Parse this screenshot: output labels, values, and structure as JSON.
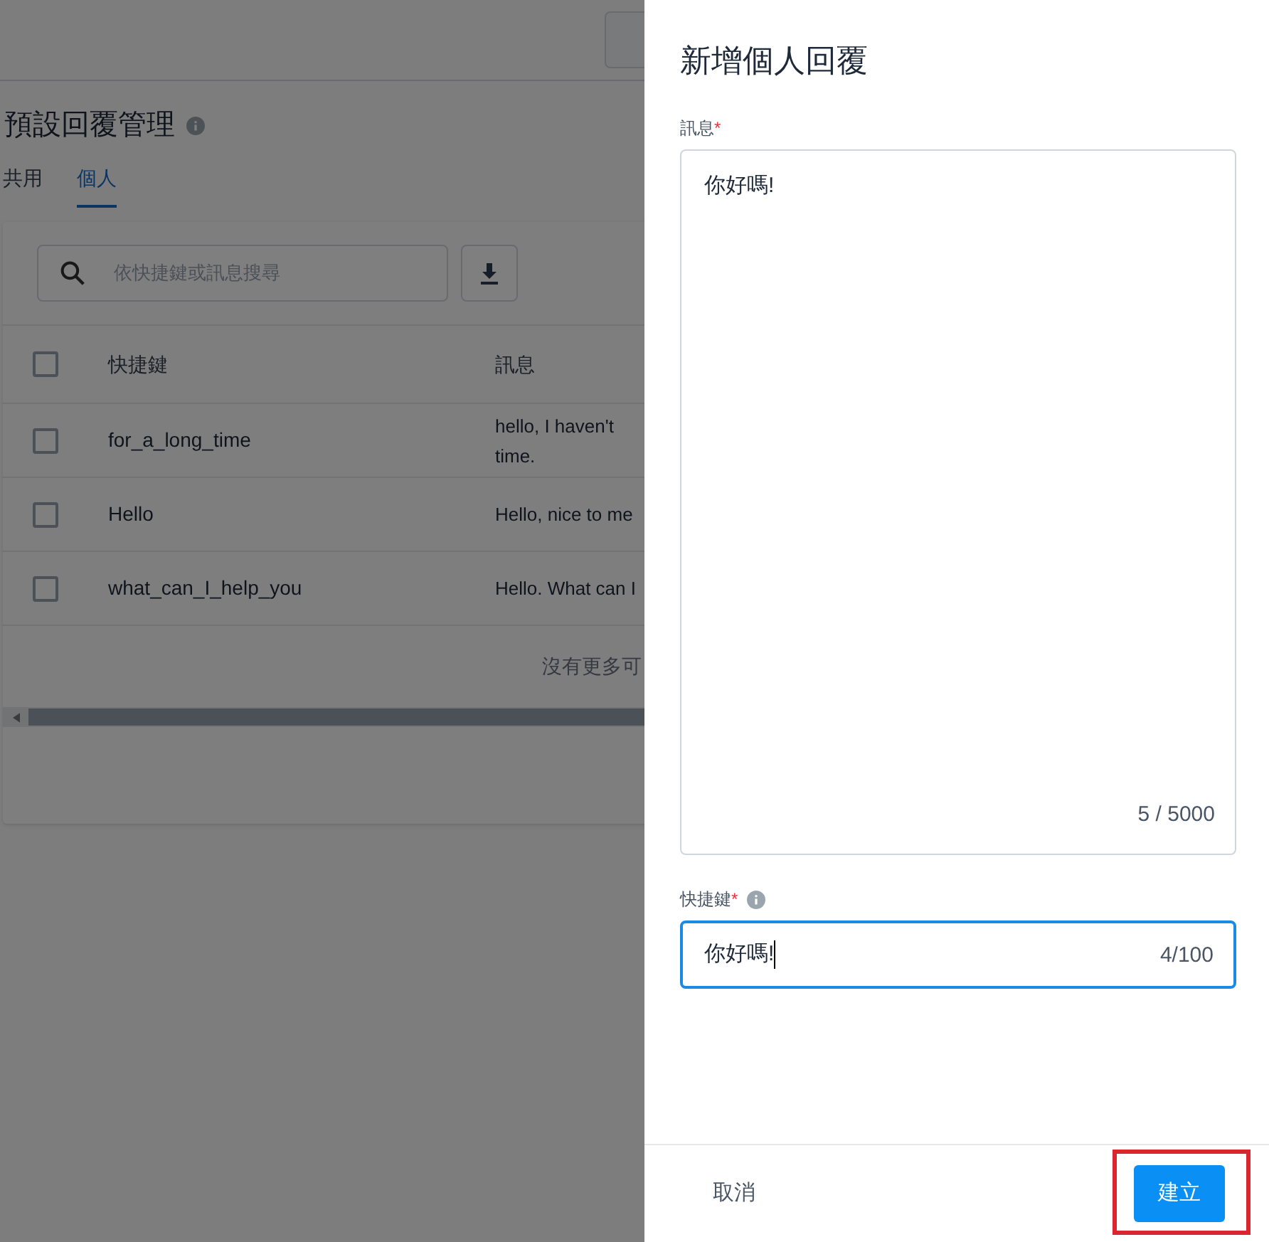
{
  "page": {
    "title": "預設回覆管理",
    "tabs": [
      {
        "label": "共用",
        "selected": false
      },
      {
        "label": "個人",
        "selected": true
      }
    ],
    "search": {
      "placeholder": "依快捷鍵或訊息搜尋"
    },
    "table": {
      "columns": [
        "快捷鍵",
        "訊息"
      ],
      "header_checked": false,
      "rows": [
        {
          "checked": false,
          "shortcut": "for_a_long_time",
          "message_lines": [
            "hello, I haven't",
            "time."
          ]
        },
        {
          "checked": false,
          "shortcut": "Hello",
          "message_lines": [
            "Hello, nice to me"
          ]
        },
        {
          "checked": false,
          "shortcut": "what_can_I_help_you",
          "message_lines": [
            "Hello. What can I"
          ]
        }
      ],
      "footer_note": "沒有更多可"
    }
  },
  "drawer": {
    "title": "新增個人回覆",
    "message_field": {
      "label": "訊息",
      "required_mark": "*",
      "value": "你好嗎!",
      "counter": "5 / 5000",
      "focused": false
    },
    "shortcut_field": {
      "label": "快捷鍵",
      "required_mark": "*",
      "value": "你好嗎!",
      "counter": "4/100",
      "focused": true
    },
    "cancel": "取消",
    "submit": "建立",
    "submit_highlighted": true
  }
}
